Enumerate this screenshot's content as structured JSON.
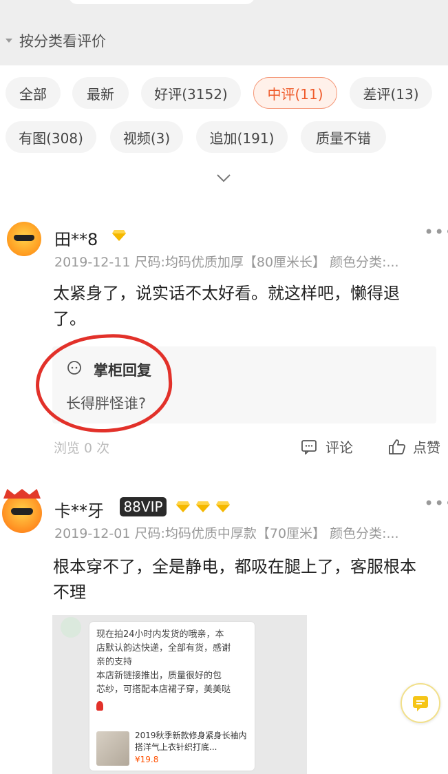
{
  "section": {
    "sort_label": "按分类看评价"
  },
  "filter_tags": [
    {
      "label": "全部",
      "active": false
    },
    {
      "label": "最新",
      "active": false
    },
    {
      "label": "好评(3152)",
      "active": false
    },
    {
      "label": "中评(11)",
      "active": true
    },
    {
      "label": "差评(13)",
      "active": false
    },
    {
      "label": "有图(308)",
      "active": false
    },
    {
      "label": "视频(3)",
      "active": false
    },
    {
      "label": "追加(191)",
      "active": false
    },
    {
      "label": "质量不错",
      "active": false
    }
  ],
  "reviews": [
    {
      "username": "田**8",
      "diamonds": 1,
      "meta": "2019-12-11 尺码:均码优质加厚【80厘米长】 颜色分类:...",
      "content_line1": "太紧身了，说实话不太好看。就这样吧，懒得退",
      "content_line2": "了。",
      "reply": {
        "title": "掌柜回复",
        "text": "长得胖怪谁?"
      },
      "views": "浏览 0 次",
      "comment_label": "评论",
      "like_label": "点赞"
    },
    {
      "username": "卡**牙",
      "vip_badge": "88VIP",
      "diamonds": 3,
      "meta": "2019-12-01 尺码:均码优质中厚款【70厘米】 颜色分类:...",
      "content_line1": "根本穿不了，全是静电，都吸在腿上了，客服根本",
      "content_line2": "不理",
      "image_chat": {
        "line1": "现在拍24小时内发货的哦亲，本",
        "line2": "店默认韵达快递，全部有货，感谢",
        "line3": "亲的支持",
        "line4": "本店新链接推出，质量很好的包",
        "line5": "芯纱，可搭配本店裙子穿，美美哒",
        "product_title": "2019秋季新款修身紧身长袖内搭洋气上衣针织打底...",
        "product_price": "¥19.8"
      }
    }
  ],
  "colors": {
    "accent": "#ef5a2a",
    "circle": "#e2312a",
    "diamond": "#f5b800"
  },
  "more_symbol": "•••"
}
